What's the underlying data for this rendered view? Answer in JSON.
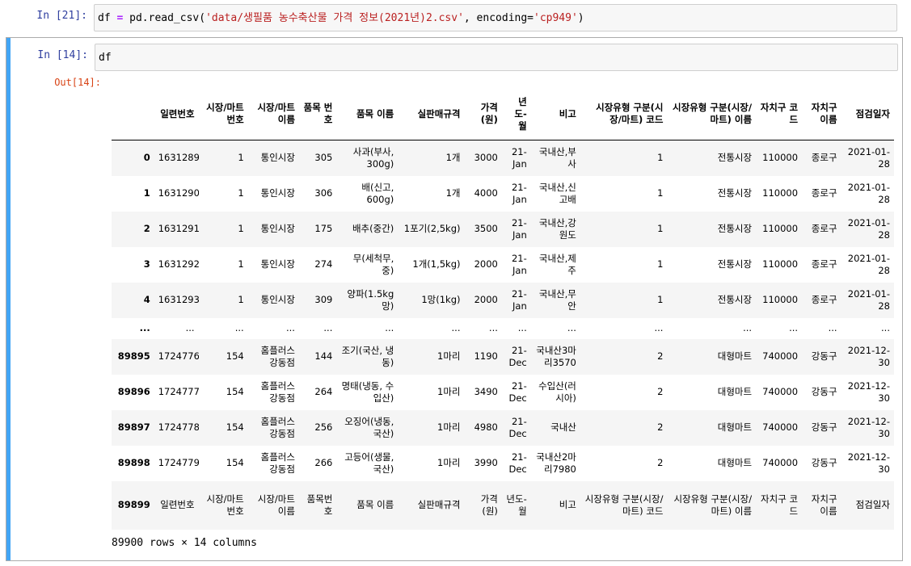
{
  "cell_in21": {
    "prompt": "In [21]:",
    "code_parts": [
      "df",
      " = ",
      "pd.read_csv(",
      "'data/생필품 농수축산물 가격 정보(2021년)2.csv'",
      ", encoding=",
      "'cp949'",
      ")"
    ]
  },
  "cell_in14": {
    "prompt": "In [14]:",
    "code": "df",
    "out_prompt": "Out[14]:"
  },
  "dataframe": {
    "columns": [
      "",
      "일련번호",
      "시장/마트 번호",
      "시장/마트 이름",
      "품목 번호",
      "품목 이름",
      "실판매규격",
      "가격(원)",
      "년도-월",
      "비고",
      "시장유형 구분(시장/마트) 코드",
      "시장유형 구분(시장/마트) 이름",
      "자치구 코드",
      "자치구 이름",
      "점검일자"
    ],
    "rows": [
      [
        "0",
        "1631289",
        "1",
        "통인시장",
        "305",
        "사과(부사, 300g)",
        "1개",
        "3000",
        "21-Jan",
        "국내산,부사",
        "1",
        "전통시장",
        "110000",
        "종로구",
        "2021-01-28"
      ],
      [
        "1",
        "1631290",
        "1",
        "통인시장",
        "306",
        "배(신고, 600g)",
        "1개",
        "4000",
        "21-Jan",
        "국내산,신고배",
        "1",
        "전통시장",
        "110000",
        "종로구",
        "2021-01-28"
      ],
      [
        "2",
        "1631291",
        "1",
        "통인시장",
        "175",
        "배추(중간)",
        "1포기(2,5kg)",
        "3500",
        "21-Jan",
        "국내산,강원도",
        "1",
        "전통시장",
        "110000",
        "종로구",
        "2021-01-28"
      ],
      [
        "3",
        "1631292",
        "1",
        "통인시장",
        "274",
        "무(세척무, 중)",
        "1개(1,5kg)",
        "2000",
        "21-Jan",
        "국내산,제주",
        "1",
        "전통시장",
        "110000",
        "종로구",
        "2021-01-28"
      ],
      [
        "4",
        "1631293",
        "1",
        "통인시장",
        "309",
        "양파(1.5kg 망)",
        "1망(1kg)",
        "2000",
        "21-Jan",
        "국내산,무안",
        "1",
        "전통시장",
        "110000",
        "종로구",
        "2021-01-28"
      ],
      [
        "...",
        "...",
        "...",
        "...",
        "...",
        "...",
        "...",
        "...",
        "...",
        "...",
        "...",
        "...",
        "...",
        "...",
        "..."
      ],
      [
        "89895",
        "1724776",
        "154",
        "홈플러스 강동점",
        "144",
        "조기(국산, 냉동)",
        "1마리",
        "1190",
        "21-Dec",
        "국내산3마리3570",
        "2",
        "대형마트",
        "740000",
        "강동구",
        "2021-12-30"
      ],
      [
        "89896",
        "1724777",
        "154",
        "홈플러스 강동점",
        "264",
        "명태(냉동, 수입산)",
        "1마리",
        "3490",
        "21-Dec",
        "수입산(러시아)",
        "2",
        "대형마트",
        "740000",
        "강동구",
        "2021-12-30"
      ],
      [
        "89897",
        "1724778",
        "154",
        "홈플러스 강동점",
        "256",
        "오징어(냉동,국산)",
        "1마리",
        "4980",
        "21-Dec",
        "국내산",
        "2",
        "대형마트",
        "740000",
        "강동구",
        "2021-12-30"
      ],
      [
        "89898",
        "1724779",
        "154",
        "홈플러스 강동점",
        "266",
        "고등어(생물,국산)",
        "1마리",
        "3990",
        "21-Dec",
        "국내산2마리7980",
        "2",
        "대형마트",
        "740000",
        "강동구",
        "2021-12-30"
      ],
      [
        "89899",
        "일련번호",
        "시장/마트 번호",
        "시장/마트 이름",
        "품목번호",
        "품목 이름",
        "실판매규격",
        "가격(원)",
        "년도-월",
        "비고",
        "시장유형 구분(시장/마트) 코드",
        "시장유형 구분(시장/마트) 이름",
        "자치구 코드",
        "자치구 이름",
        "점검일자"
      ]
    ],
    "summary": "89900 rows × 14 columns"
  }
}
